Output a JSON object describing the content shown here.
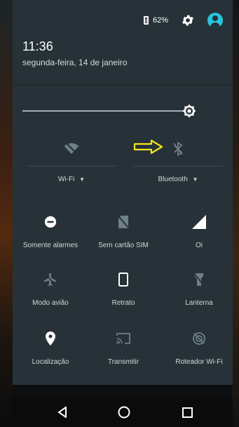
{
  "status": {
    "battery_percent": "62%"
  },
  "header": {
    "time": "11:36",
    "date": "segunda-feira, 14 de janeiro"
  },
  "brightness": {
    "level_fraction": 0.96
  },
  "tiles_big": [
    {
      "label": "Wi-Fi",
      "icon": "wifi-off-icon"
    },
    {
      "label": "Bluetooth",
      "icon": "bluetooth-off-icon"
    }
  ],
  "tiles": [
    {
      "label": "Somente alarmes",
      "icon": "do-not-disturb-icon"
    },
    {
      "label": "Sem cartão SIM",
      "icon": "no-sim-icon"
    },
    {
      "label": "Oi",
      "icon": "signal-icon"
    },
    {
      "label": "Modo avião",
      "icon": "airplane-icon"
    },
    {
      "label": "Retrato",
      "icon": "portrait-icon"
    },
    {
      "label": "Lanterna",
      "icon": "flashlight-icon"
    },
    {
      "label": "Localização",
      "icon": "location-icon"
    },
    {
      "label": "Transmitir",
      "icon": "cast-icon"
    },
    {
      "label": "Roteador Wi-Fi",
      "icon": "hotspot-icon"
    }
  ],
  "colors": {
    "panel": "#263238",
    "accent": "#26c6da",
    "annotation_arrow": "#f5e51b"
  }
}
